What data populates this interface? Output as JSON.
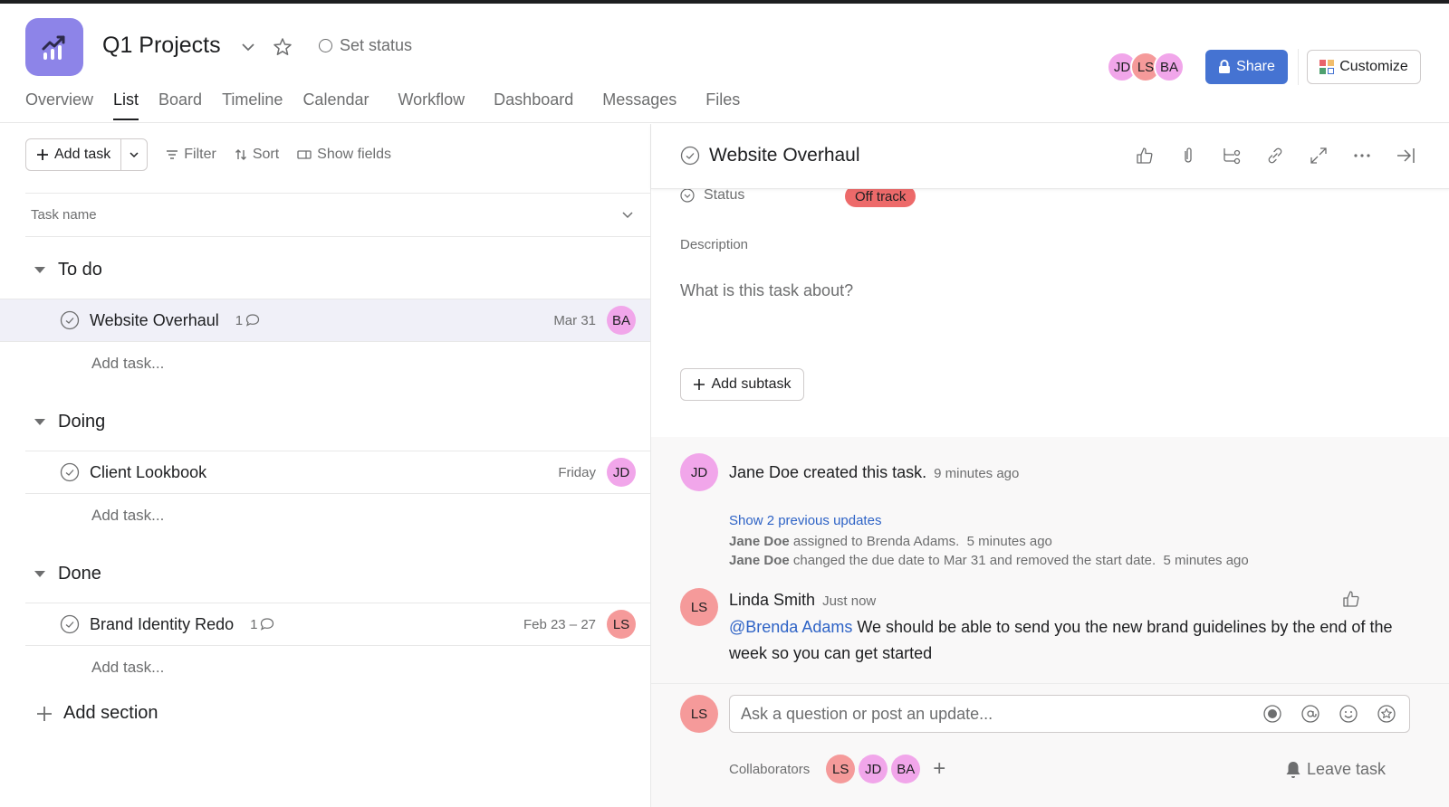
{
  "project": {
    "title": "Q1 Projects",
    "set_status_label": "Set status",
    "icon": "trending-chart-icon",
    "icon_color": "#8d84e8"
  },
  "tabs": [
    {
      "label": "Overview",
      "active": false
    },
    {
      "label": "List",
      "active": true
    },
    {
      "label": "Board",
      "active": false
    },
    {
      "label": "Timeline",
      "active": false
    },
    {
      "label": "Calendar",
      "active": false
    },
    {
      "label": "Workflow",
      "active": false
    },
    {
      "label": "Dashboard",
      "active": false
    },
    {
      "label": "Messages",
      "active": false
    },
    {
      "label": "Files",
      "active": false
    }
  ],
  "header_members": [
    "JD",
    "LS",
    "BA"
  ],
  "share_label": "Share",
  "customize_label": "Customize",
  "colors": {
    "accent_blue": "#4573d2",
    "pink_avatar": "#f1a6ea",
    "red_avatar": "#f59a9a",
    "off_track": "#ed6a6a",
    "link": "#2e63c6",
    "selected_row": "#f0f0f8"
  },
  "toolbar": {
    "add_task": "Add task",
    "filter": "Filter",
    "sort": "Sort",
    "show_fields": "Show fields"
  },
  "list": {
    "column_header": "Task name",
    "add_task_placeholder": "Add task...",
    "add_section": "Add section",
    "sections": [
      {
        "name": "To do",
        "tasks": [
          {
            "name": "Website Overhaul",
            "comments": "1",
            "date": "Mar 31",
            "assignee": "BA",
            "selected": true
          }
        ]
      },
      {
        "name": "Doing",
        "tasks": [
          {
            "name": "Client Lookbook",
            "comments": "",
            "date": "Friday",
            "assignee": "JD",
            "selected": false
          }
        ]
      },
      {
        "name": "Done",
        "tasks": [
          {
            "name": "Brand Identity Redo",
            "comments": "1",
            "date": "Feb 23 – 27",
            "assignee": "LS",
            "selected": false
          }
        ]
      }
    ]
  },
  "detail": {
    "title": "Website Overhaul",
    "status_label": "Status",
    "status_value": "Off track",
    "description_label": "Description",
    "description_placeholder": "What is this task about?",
    "add_subtask": "Add subtask",
    "activity": {
      "created": {
        "avatar": "JD",
        "text": "Jane Doe created this task.",
        "time": "9 minutes ago"
      },
      "show_previous": "Show 2 previous updates",
      "updates": [
        {
          "actor": "Jane Doe",
          "text": "assigned to Brenda Adams.",
          "time": "5 minutes ago"
        },
        {
          "actor": "Jane Doe",
          "text": "changed the due date to Mar 31 and removed the start date.",
          "time": "5 minutes ago"
        }
      ],
      "comment": {
        "avatar": "LS",
        "author": "Linda Smith",
        "time": "Just now",
        "mention": "@Brenda Adams",
        "body": "We should be able to send you the new brand guidelines by the end of the week so you can get started"
      }
    },
    "composer": {
      "avatar": "LS",
      "placeholder": "Ask a question or post an update..."
    },
    "collaborators_label": "Collaborators",
    "collaborators": [
      "LS",
      "JD",
      "BA"
    ],
    "leave_task": "Leave task"
  }
}
